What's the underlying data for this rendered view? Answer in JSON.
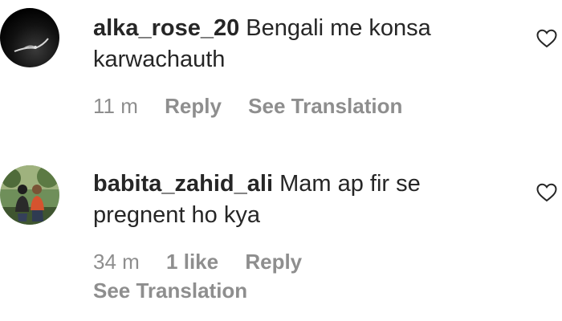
{
  "comments": [
    {
      "username": "alka_rose_20",
      "text": "Bengali me konsa karwachauth",
      "time": "11 m",
      "likes": "",
      "reply_label": "Reply",
      "translation_label": "See Translation"
    },
    {
      "username": "babita_zahid_ali",
      "text": "Mam ap fir se pregnent ho kya",
      "time": "34 m",
      "likes": "1 like",
      "reply_label": "Reply",
      "translation_label": "See Translation"
    }
  ],
  "icons": {
    "like": "heart-outline-icon"
  },
  "colors": {
    "text_primary": "#262626",
    "text_secondary": "#8e8e8e",
    "background": "#ffffff"
  }
}
